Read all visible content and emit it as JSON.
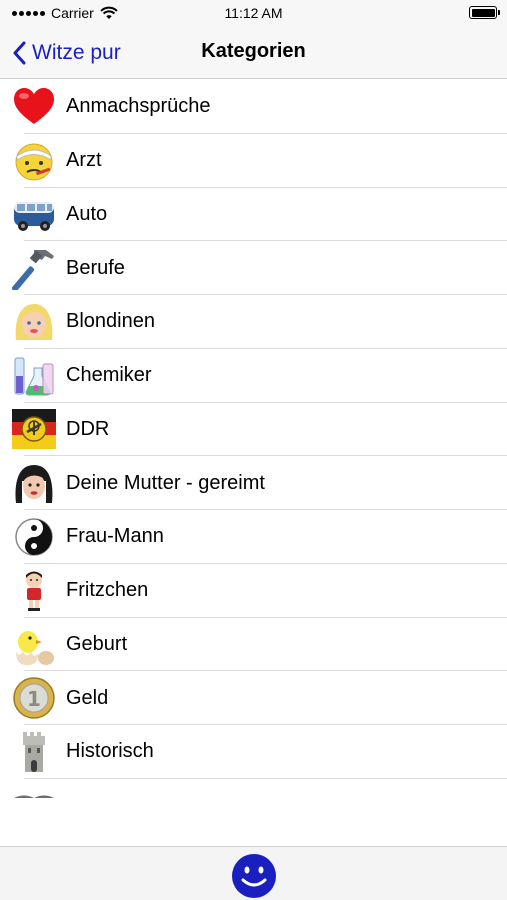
{
  "status_bar": {
    "carrier": "Carrier",
    "time": "11:12 AM",
    "wifi_icon": "wifi-icon",
    "battery_icon": "battery-icon"
  },
  "nav": {
    "back_label": "Witze pur",
    "title": "Kategorien"
  },
  "categories": [
    {
      "label": "Anmachsprüche",
      "icon": "heart-icon"
    },
    {
      "label": "Arzt",
      "icon": "sick-face-icon"
    },
    {
      "label": "Auto",
      "icon": "van-icon"
    },
    {
      "label": "Berufe",
      "icon": "hammer-icon"
    },
    {
      "label": "Blondinen",
      "icon": "blonde-face-icon"
    },
    {
      "label": "Chemiker",
      "icon": "lab-flask-icon"
    },
    {
      "label": "DDR",
      "icon": "ddr-emblem-icon"
    },
    {
      "label": "Deine Mutter - gereimt",
      "icon": "woman-face-icon"
    },
    {
      "label": "Frau-Mann",
      "icon": "yin-yang-icon"
    },
    {
      "label": "Fritzchen",
      "icon": "boy-figure-icon"
    },
    {
      "label": "Geburt",
      "icon": "chick-egg-icon"
    },
    {
      "label": "Geld",
      "icon": "euro-coin-icon"
    },
    {
      "label": "Historisch",
      "icon": "tower-icon"
    },
    {
      "label": "",
      "icon": "book-icon"
    }
  ],
  "tab_bar": {
    "smiley_icon": "smiley-icon",
    "accent_color": "#1a1fbf"
  }
}
